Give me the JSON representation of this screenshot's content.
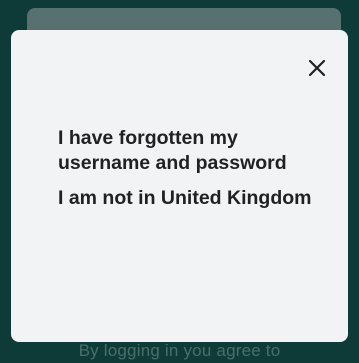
{
  "background": {
    "footer_text": "By logging in you agree to",
    "colors": {
      "backdrop": "#0e3b37",
      "sheet": "#f2f3f4",
      "text": "#1e2222"
    }
  },
  "dialog": {
    "close_icon": "close-icon",
    "options": [
      {
        "label": "I have forgotten my username and password"
      },
      {
        "label": "I am not in United Kingdom"
      }
    ]
  }
}
